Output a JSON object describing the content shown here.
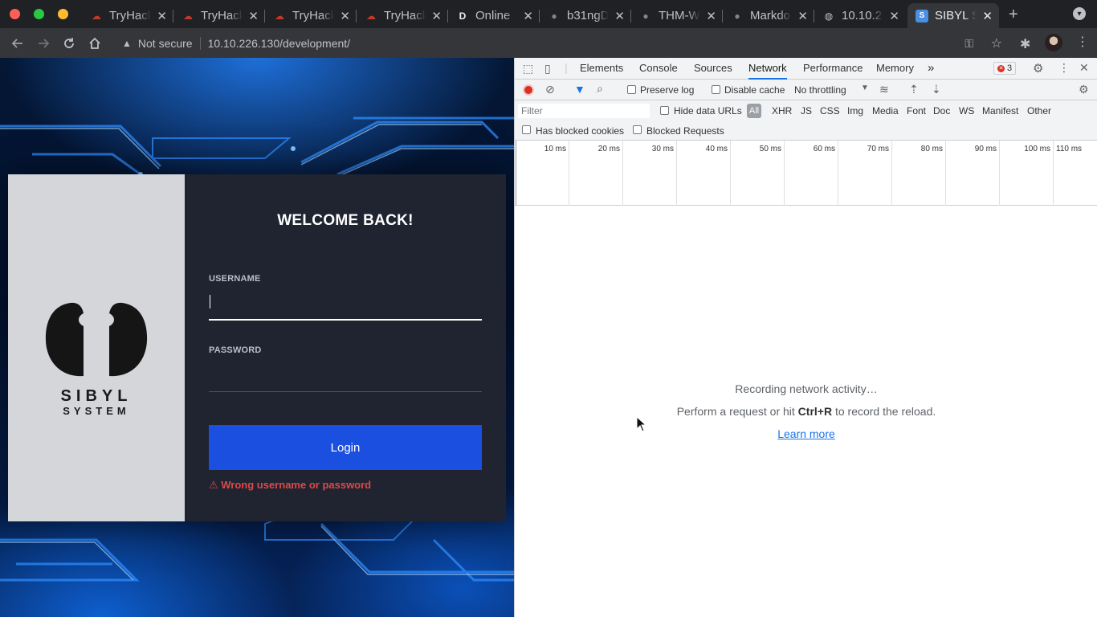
{
  "browser": {
    "tabs": [
      {
        "title": "TryHackMe",
        "icon": "tryhackme-icon"
      },
      {
        "title": "TryHackMe",
        "icon": "tryhackme-icon"
      },
      {
        "title": "TryHackMe",
        "icon": "tryhackme-icon"
      },
      {
        "title": "TryHackMe",
        "icon": "tryhackme-icon"
      },
      {
        "title": "Online",
        "icon": "d-icon"
      },
      {
        "title": "b31ngD",
        "icon": "github-icon"
      },
      {
        "title": "THM-W",
        "icon": "github-icon"
      },
      {
        "title": "Markdo",
        "icon": "github-icon"
      },
      {
        "title": "10.10.2",
        "icon": "globe-icon"
      },
      {
        "title": "SIBYL S",
        "icon": "sibyl-icon",
        "active": true
      }
    ],
    "security_label": "Not secure",
    "url": "10.10.226.130/development/"
  },
  "login": {
    "logo_line1": "SIBYL",
    "logo_line2": "SYSTEM",
    "heading": "WELCOME BACK!",
    "username_label": "USERNAME",
    "username_value": "",
    "password_label": "PASSWORD",
    "password_value": "",
    "button_label": "Login",
    "error_message": "⚠ Wrong username or password"
  },
  "devtools": {
    "tabs": [
      "Elements",
      "Console",
      "Sources",
      "Network",
      "Performance",
      "Memory"
    ],
    "active_tab": "Network",
    "more_tabs": "»",
    "error_count": "3",
    "preserve_log_label": "Preserve log",
    "disable_cache_label": "Disable cache",
    "throttling_value": "No throttling",
    "filter_placeholder": "Filter",
    "hide_data_urls_label": "Hide data URLs",
    "type_filters": [
      "All",
      "XHR",
      "JS",
      "CSS",
      "Img",
      "Media",
      "Font",
      "Doc",
      "WS",
      "Manifest",
      "Other"
    ],
    "has_blocked_cookies_label": "Has blocked cookies",
    "blocked_requests_label": "Blocked Requests",
    "timeline_ticks": [
      "10 ms",
      "20 ms",
      "30 ms",
      "40 ms",
      "50 ms",
      "60 ms",
      "70 ms",
      "80 ms",
      "90 ms",
      "100 ms",
      "110 ms"
    ],
    "empty_line1": "Recording network activity…",
    "empty_line2_prefix": "Perform a request or hit ",
    "empty_line2_shortcut": "Ctrl+R",
    "empty_line2_suffix": " to record the reload.",
    "learn_more": "Learn more"
  },
  "colors": {
    "login_button": "#1b4fe0",
    "error_text": "#e04848",
    "devtools_accent": "#1a73e8",
    "record_red": "#d93025"
  }
}
